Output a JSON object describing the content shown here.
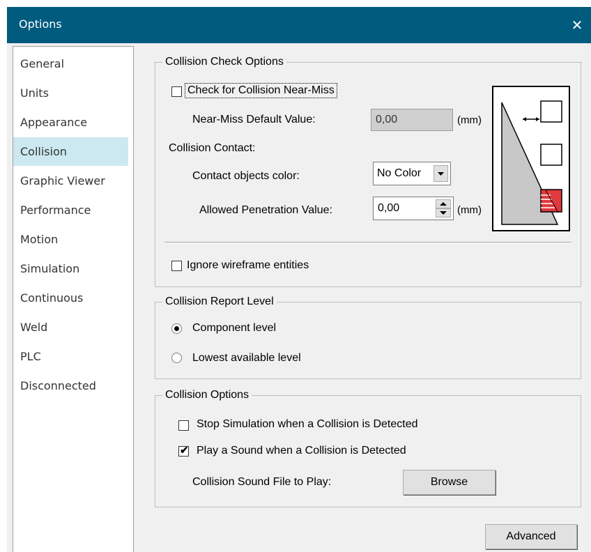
{
  "window": {
    "title": "Options",
    "close_glyph": "✕"
  },
  "sidebar": {
    "items": [
      {
        "label": "General"
      },
      {
        "label": "Units"
      },
      {
        "label": "Appearance"
      },
      {
        "label": "Collision",
        "selected": true
      },
      {
        "label": "Graphic Viewer"
      },
      {
        "label": "Performance"
      },
      {
        "label": "Motion"
      },
      {
        "label": "Simulation"
      },
      {
        "label": "Continuous"
      },
      {
        "label": "Weld"
      },
      {
        "label": "PLC"
      },
      {
        "label": "Disconnected"
      }
    ]
  },
  "collision_check": {
    "legend": "Collision Check Options",
    "near_miss_checkbox": {
      "label": "Check for Collision Near-Miss",
      "checked": false
    },
    "near_miss_default": {
      "label": "Near-Miss Default Value:",
      "value": "0,00",
      "unit": "(mm)"
    },
    "contact_label": "Collision Contact:",
    "contact_color": {
      "label": "Contact objects color:",
      "value": "No Color"
    },
    "penetration": {
      "label": "Allowed Penetration Value:",
      "value": "0,00",
      "unit": "(mm)"
    },
    "ignore_wireframe": {
      "label": "Ignore wireframe entities",
      "checked": false
    }
  },
  "report_level": {
    "legend": "Collision Report Level",
    "options": [
      {
        "label": "Component level",
        "selected": true
      },
      {
        "label": "Lowest available level",
        "selected": false
      }
    ]
  },
  "collision_options": {
    "legend": "Collision Options",
    "stop_simulation": {
      "label": "Stop Simulation when a Collision is Detected",
      "checked": false
    },
    "play_sound": {
      "label": "Play a Sound when a Collision is Detected",
      "checked": true,
      "check_glyph": "✔"
    },
    "sound_file": {
      "label": "Collision Sound File to Play:",
      "button": "Browse"
    }
  },
  "advanced_button": "Advanced",
  "colors": {
    "titlebar": "#005b7e",
    "selection": "#cce8f0",
    "contact_red": "#e0393e",
    "diagram_fill": "#c8c8c8"
  },
  "icons": {
    "close": "close-icon",
    "dropdown": "chevron-down-icon",
    "spinner": "spin-updown-icon",
    "diagram": "collision-diagram-icon"
  }
}
